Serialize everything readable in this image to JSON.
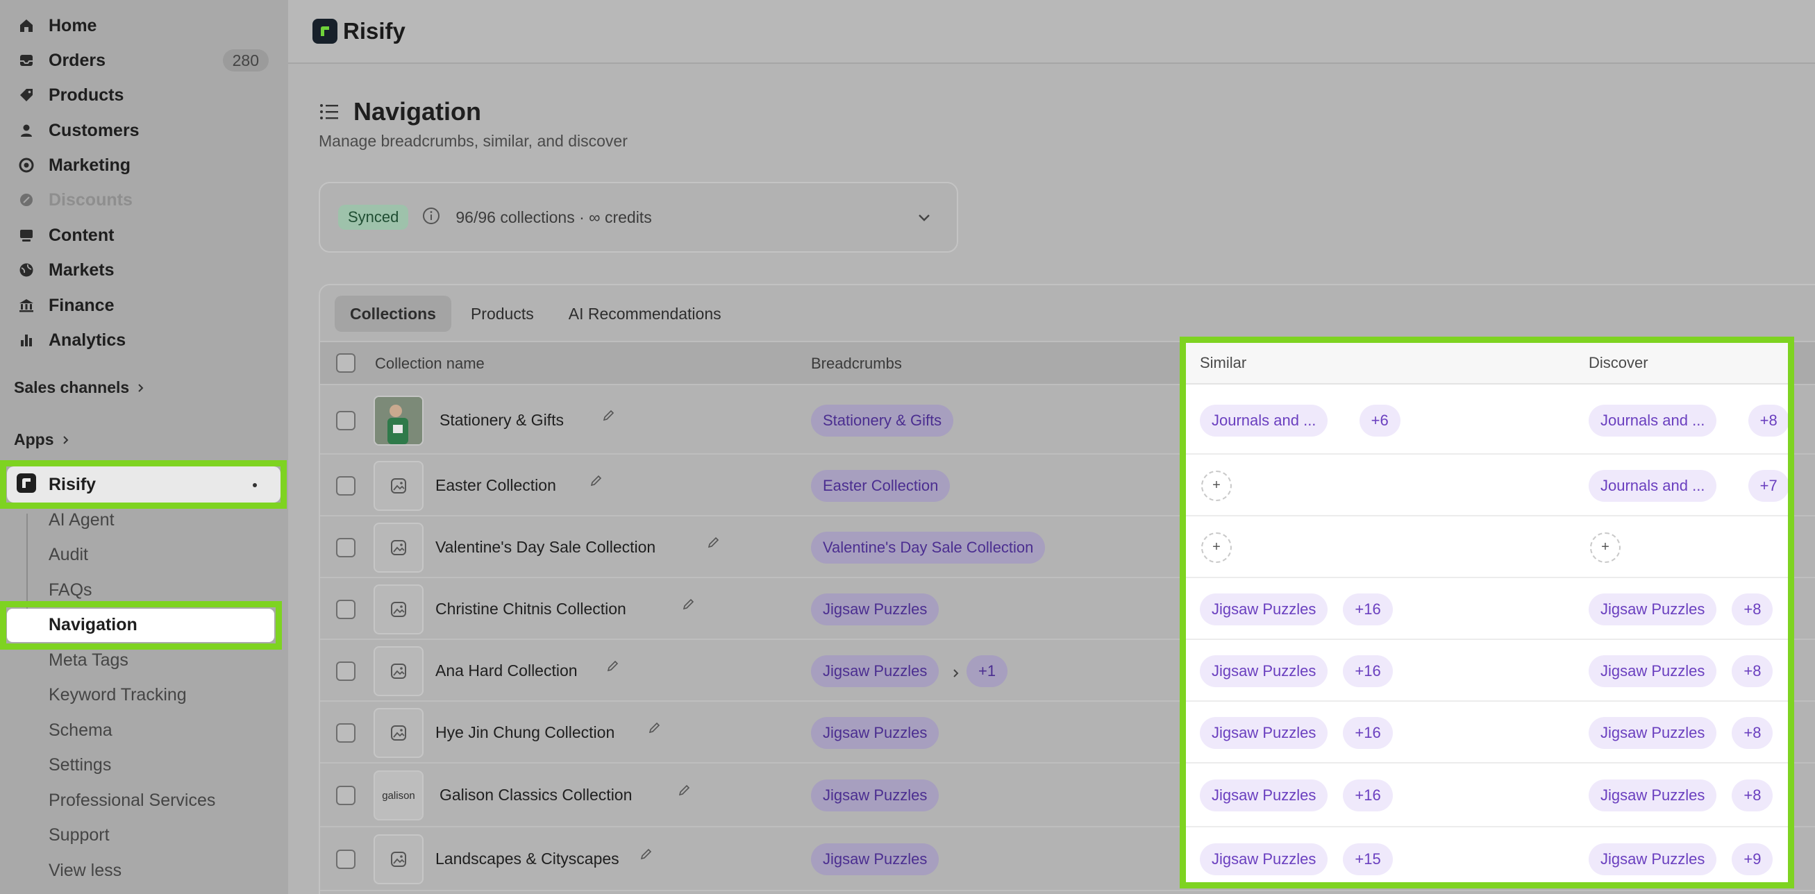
{
  "sidebar": {
    "items": [
      {
        "label": "Home",
        "icon": "home-icon"
      },
      {
        "label": "Orders",
        "icon": "inbox-icon",
        "count": "280"
      },
      {
        "label": "Products",
        "icon": "tag-icon"
      },
      {
        "label": "Customers",
        "icon": "person-icon"
      },
      {
        "label": "Marketing",
        "icon": "target-icon"
      },
      {
        "label": "Discounts",
        "icon": "discount-icon",
        "disabled": true
      },
      {
        "label": "Content",
        "icon": "content-icon"
      },
      {
        "label": "Markets",
        "icon": "globe-icon"
      },
      {
        "label": "Finance",
        "icon": "bank-icon"
      },
      {
        "label": "Analytics",
        "icon": "chart-icon"
      }
    ],
    "sales_channels": "Sales channels",
    "apps": "Apps",
    "app_name": "Risify",
    "app_sub_items": [
      "AI Agent",
      "Audit",
      "FAQs",
      "Navigation",
      "Meta Tags",
      "Keyword Tracking",
      "Schema",
      "Settings",
      "Professional Services",
      "Support",
      "View less"
    ]
  },
  "topbar": {
    "brand": "Risify"
  },
  "page": {
    "title": "Navigation",
    "subtitle": "Manage breadcrumbs, similar, and discover"
  },
  "sync": {
    "badge": "Synced",
    "text": "96/96 collections · ∞ credits"
  },
  "tabs": [
    "Collections",
    "Products",
    "AI Recommendations"
  ],
  "table": {
    "headers": {
      "name": "Collection name",
      "breadcrumbs": "Breadcrumbs",
      "similar": "Similar",
      "discover": "Discover"
    },
    "rows": [
      {
        "name": "Stationery & Gifts",
        "thumb": "photo",
        "crumbs": [
          "Stationery & Gifts"
        ],
        "crumb_more": "",
        "similar": "Journals and ...",
        "similar_more": "+6",
        "discover": "Journals and ...",
        "discover_more": "+8"
      },
      {
        "name": "Easter Collection",
        "thumb": "placeholder",
        "crumbs": [
          "Easter Collection"
        ],
        "crumb_more": "",
        "similar": "",
        "similar_more": "",
        "discover": "Journals and ...",
        "discover_more": "+7"
      },
      {
        "name": "Valentine's Day Sale Collection",
        "thumb": "placeholder",
        "crumbs": [
          "Valentine's Day Sale Collection"
        ],
        "crumb_more": "",
        "similar": "",
        "similar_more": "",
        "discover": "",
        "discover_more": ""
      },
      {
        "name": "Christine Chitnis Collection",
        "thumb": "placeholder",
        "crumbs": [
          "Jigsaw Puzzles"
        ],
        "crumb_more": "",
        "similar": "Jigsaw Puzzles",
        "similar_more": "+16",
        "discover": "Jigsaw Puzzles",
        "discover_more": "+8"
      },
      {
        "name": "Ana Hard Collection",
        "thumb": "placeholder",
        "crumbs": [
          "Jigsaw Puzzles"
        ],
        "crumb_more": "+1",
        "similar": "Jigsaw Puzzles",
        "similar_more": "+16",
        "discover": "Jigsaw Puzzles",
        "discover_more": "+8"
      },
      {
        "name": "Hye Jin Chung Collection",
        "thumb": "placeholder",
        "crumbs": [
          "Jigsaw Puzzles"
        ],
        "crumb_more": "",
        "similar": "Jigsaw Puzzles",
        "similar_more": "+16",
        "discover": "Jigsaw Puzzles",
        "discover_more": "+8"
      },
      {
        "name": "Galison Classics Collection",
        "thumb": "galison",
        "thumb_text": "galison",
        "crumbs": [
          "Jigsaw Puzzles"
        ],
        "crumb_more": "",
        "similar": "Jigsaw Puzzles",
        "similar_more": "+16",
        "discover": "Jigsaw Puzzles",
        "discover_more": "+8"
      },
      {
        "name": "Landscapes & Cityscapes",
        "thumb": "placeholder",
        "crumbs": [
          "Jigsaw Puzzles"
        ],
        "crumb_more": "",
        "similar": "Jigsaw Puzzles",
        "similar_more": "+15",
        "discover": "Jigsaw Puzzles",
        "discover_more": "+9"
      }
    ]
  },
  "add_symbol": "+",
  "colors": {
    "highlight": "#7ed321",
    "pill_text": "#6a3fbf",
    "pill_bg": "#efe9fb",
    "synced_bg": "#9ec2ab"
  }
}
